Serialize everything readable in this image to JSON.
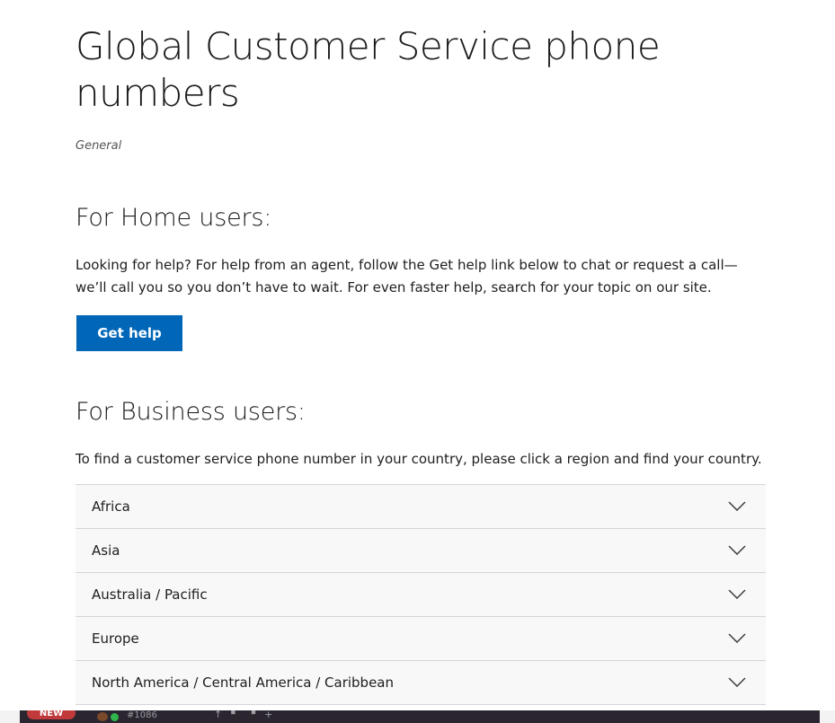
{
  "page": {
    "title": "Global Customer Service phone numbers",
    "category": "General"
  },
  "home": {
    "heading": "For Home users:",
    "text": "Looking for help? For help from an agent, follow the Get help link below to chat or request a call—we’ll call you so you don’t have to wait. For even faster help, search for your topic on our site.",
    "button_label": "Get help"
  },
  "business": {
    "heading": "For Business users:",
    "text": "To find a customer service phone number in your country, please click a region and find your country.",
    "regions": [
      {
        "label": "Africa",
        "expanded": false
      },
      {
        "label": "Asia",
        "expanded": false
      },
      {
        "label": "Australia / Pacific",
        "expanded": false
      },
      {
        "label": "Europe",
        "expanded": false
      },
      {
        "label": "North America / Central America / Caribbean",
        "expanded": false
      }
    ]
  },
  "taskbar": {
    "badge": "NEW",
    "tag": "#1086",
    "icons": [
      "pin-icon",
      "grid-icon",
      "plus-icon"
    ]
  },
  "colors": {
    "accent": "#0067b8",
    "accordion_bg": "#f8f8f8",
    "divider": "#d6d6d6",
    "taskbar_bg": "#2b2530",
    "badge_bg": "#c0393b"
  }
}
